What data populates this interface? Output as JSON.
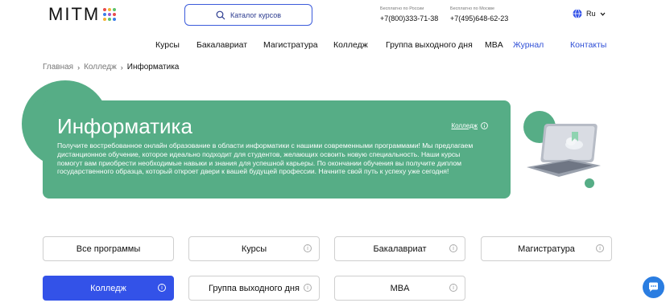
{
  "header": {
    "logo_text": "MITM",
    "logo_dots": [
      "#e94b4b",
      "#f2b233",
      "#5cc46a",
      "#3b7de8",
      "#9b59d0",
      "#e94b4b",
      "#f2b233",
      "#5cc46a",
      "#3b7de8"
    ],
    "search_label": "Каталог курсов",
    "phones": [
      {
        "caption": "Бесплатно по России",
        "number": "+7(800)333-71-38"
      },
      {
        "caption": "Бесплатно по Москве",
        "number": "+7(495)648-62-23"
      }
    ],
    "lang": "Ru"
  },
  "nav": {
    "items": [
      "Курсы",
      "Бакалавриат",
      "Магистратура",
      "Колледж",
      "Группа выходного дня",
      "MBA",
      "Журнал",
      "Контакты"
    ]
  },
  "breadcrumb": {
    "items": [
      "Главная",
      "Колледж",
      "Информатика"
    ]
  },
  "hero": {
    "title": "Информатика",
    "link": "Колледж",
    "description": "Получите востребованное онлайн образование в области информатики с нашими современными программами! Мы предлагаем дистанционное обучение, которое идеально подходит для студентов, желающих освоить новую специальность. Наши курсы помогут вам приобрести необходимые навыки и знания для успешной карьеры. По окончании обучения вы получите диплом государственного образца, который откроет двери к вашей будущей профессии. Начните свой путь к успеху уже сегодня!"
  },
  "filters": [
    {
      "label": "Все программы",
      "info": false,
      "active": false
    },
    {
      "label": "Курсы",
      "info": true,
      "active": false
    },
    {
      "label": "Бакалавриат",
      "info": true,
      "active": false
    },
    {
      "label": "Магистратура",
      "info": true,
      "active": false
    },
    {
      "label": "Колледж",
      "info": true,
      "active": true
    },
    {
      "label": "Группа выходного дня",
      "info": true,
      "active": false
    },
    {
      "label": "MBA",
      "info": true,
      "active": false
    }
  ],
  "colors": {
    "accent_green": "#56ad86",
    "accent_blue": "#3352e8",
    "chat_blue": "#2a7de1"
  }
}
